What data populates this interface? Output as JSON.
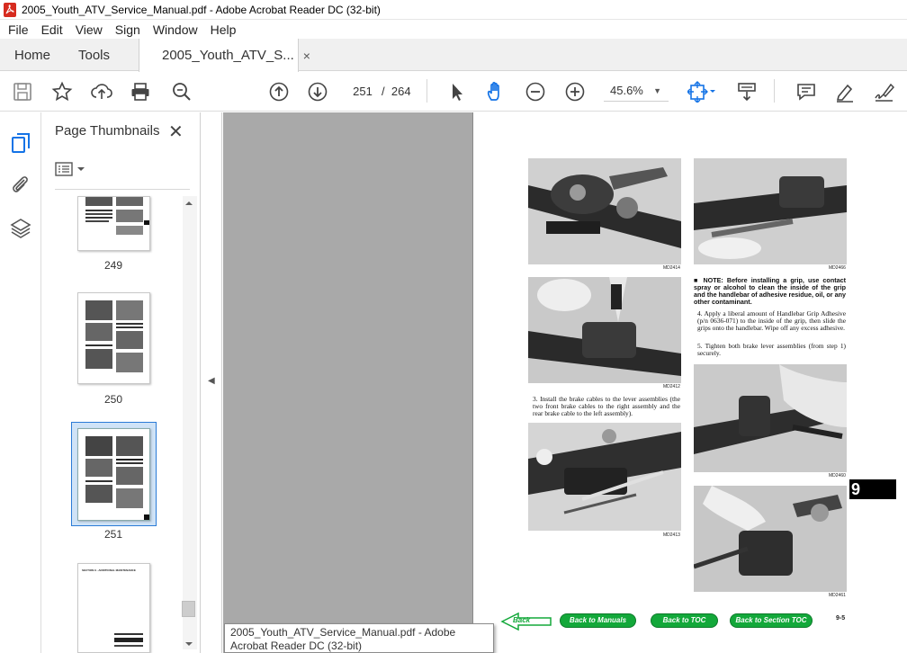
{
  "window": {
    "title": "2005_Youth_ATV_Service_Manual.pdf - Adobe Acrobat Reader DC (32-bit)"
  },
  "menu": [
    "File",
    "Edit",
    "View",
    "Sign",
    "Window",
    "Help"
  ],
  "tabs": {
    "home": "Home",
    "tools": "Tools",
    "document": "2005_Youth_ATV_S...",
    "close": "×"
  },
  "toolbar": {
    "current_page": "251",
    "separator": "/",
    "total_pages": "264",
    "zoom": "45.6%",
    "icons": [
      "save-icon",
      "star-icon",
      "upload-icon",
      "print-icon",
      "zoom-search-icon",
      "page-up-icon",
      "page-down-icon",
      "select-arrow-icon",
      "hand-icon",
      "zoom-out-icon",
      "zoom-in-icon",
      "fit-page-icon",
      "scroll-mode-icon",
      "comment-icon",
      "highlight-icon",
      "sign-icon"
    ]
  },
  "sidebar": {
    "title": "Page Thumbnails",
    "close": "✕",
    "thumbnails": [
      {
        "label": "249"
      },
      {
        "label": "250"
      },
      {
        "label": "251",
        "selected": true
      },
      {
        "label": ""
      }
    ],
    "thumb4_header": "SECTION 9 - ADDITIONAL MAINTENANCE"
  },
  "document": {
    "captions": [
      "MD2414",
      "MD2412",
      "MD2413",
      "MD2466",
      "MD2460",
      "MD2461"
    ],
    "step3": "3. Install the brake cables to the lever assemblies (the two front brake cables to the right assembly and the rear brake cable to the left assembly).",
    "note": "■ NOTE: Before installing a grip, use contact spray or alcohol to clean the inside of the grip and the handlebar of adhesive residue, oil, or any other contaminant.",
    "step4": "4. Apply a liberal amount of Handlebar Grip Adhesive (p/n 0636-071) to the inside of the grip, then slide the grips onto the handlebar. Wipe off any excess adhesive.",
    "step5": "5. Tighten both brake lever assemblies (from step 1) securely.",
    "section_tab": "9",
    "nav": {
      "back": "Back",
      "manuals": "Back to Manuals",
      "toc": "Back to TOC",
      "section_toc": "Back to Section TOC"
    },
    "page_number": "9-5"
  },
  "tooltip": "2005_Youth_ATV_Service_Manual.pdf - Adobe Acrobat Reader DC (32-bit)",
  "colors": {
    "accent": "#2b7bd6",
    "doc_bg": "#a9a9a9",
    "nav_green": "#13a83a"
  }
}
